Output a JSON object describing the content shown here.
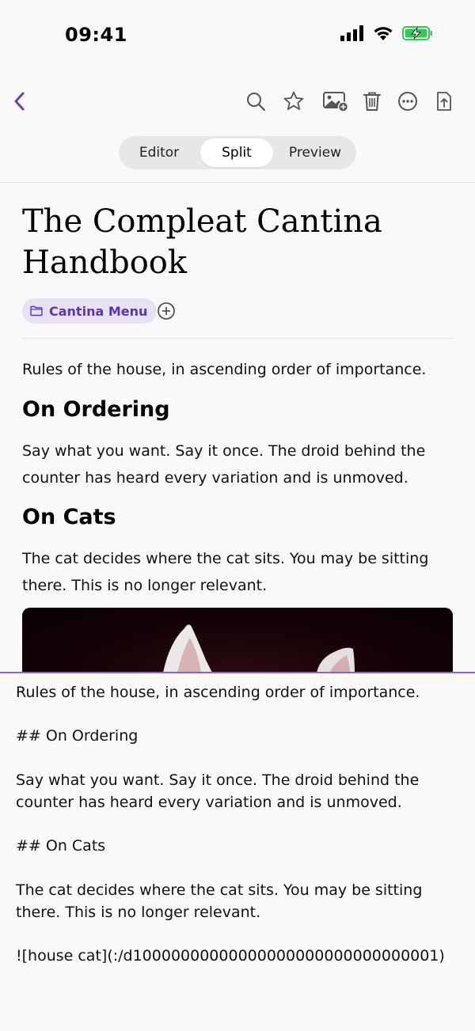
{
  "status_bar": {
    "time": "09:41"
  },
  "toolbar": {
    "icons": [
      "back-icon",
      "search-icon",
      "star-icon",
      "add-image-icon",
      "trash-icon",
      "more-icon",
      "share-icon"
    ],
    "accent": "#6b3fb8"
  },
  "view_modes": {
    "editor": "Editor",
    "split": "Split",
    "preview": "Preview",
    "selected": "Split"
  },
  "note": {
    "title": "The Compleat Cantina Handbook",
    "folder": "Cantina Menu"
  },
  "preview": {
    "intro": "Rules of the house, in ascending order of importance.",
    "h_ordering": "On Ordering",
    "p_ordering": "Say what you want. Say it once. The droid behind the counter has heard every variation and is unmoved.",
    "h_cats": "On Cats",
    "p_cats": "The cat decides where the cat sits. You may be sitting there. This is no longer relevant."
  },
  "editor": {
    "line1": "Rules of the house, in ascending order of importance.",
    "line2": "## On Ordering",
    "line3": "Say what you want. Say it once. The droid behind the counter has heard every variation and is unmoved.",
    "line4": "## On Cats",
    "line5": "The cat decides where the cat sits. You may be sitting there. This is no longer relevant.",
    "line6": "![house cat](:/d10000000000000000000000000000001)"
  }
}
